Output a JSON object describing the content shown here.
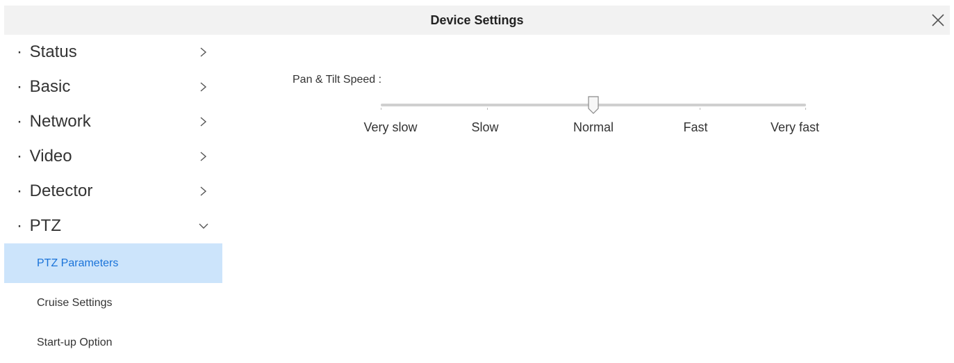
{
  "window": {
    "title": "Device Settings",
    "close_icon": "close-icon"
  },
  "sidebar": {
    "items": [
      {
        "label": "Status",
        "bullet": "·",
        "expanded": false
      },
      {
        "label": "Basic",
        "bullet": "·",
        "expanded": false
      },
      {
        "label": "Network",
        "bullet": "·",
        "expanded": false
      },
      {
        "label": "Video",
        "bullet": "·",
        "expanded": false
      },
      {
        "label": "Detector",
        "bullet": "·",
        "expanded": false
      },
      {
        "label": "PTZ",
        "bullet": "·",
        "expanded": true
      }
    ],
    "submenu": [
      {
        "label": "PTZ Parameters",
        "active": true
      },
      {
        "label": "Cruise Settings",
        "active": false
      },
      {
        "label": "Start-up Option",
        "active": false
      }
    ]
  },
  "ptz": {
    "speed_label": "Pan & Tilt Speed :",
    "speed_options": [
      "Very slow",
      "Slow",
      "Normal",
      "Fast",
      "Very fast"
    ],
    "selected_speed": "Normal"
  },
  "colors": {
    "accent": "#1a73d9",
    "active_bg": "#cce4fb",
    "titlebar_bg": "#f2f2f2"
  }
}
